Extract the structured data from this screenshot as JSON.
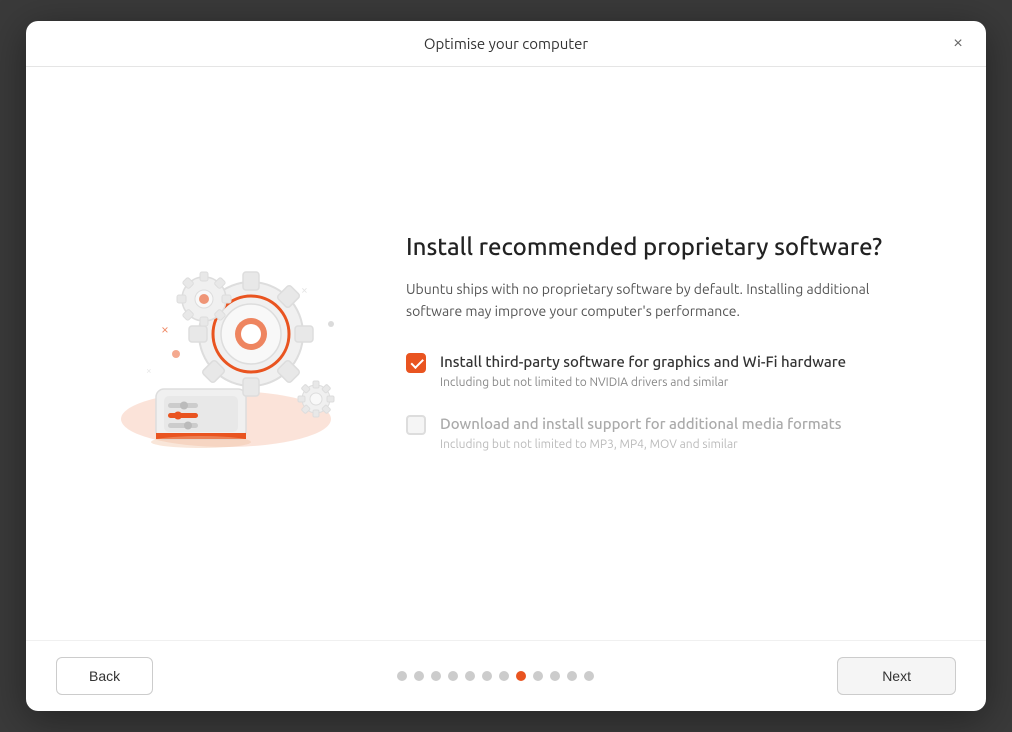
{
  "dialog": {
    "title": "Optimise your computer",
    "close_label": "×"
  },
  "content": {
    "heading": "Install recommended proprietary software?",
    "description": "Ubuntu ships with no proprietary software by default. Installing additional software may improve your computer's performance.",
    "options": [
      {
        "id": "third-party",
        "label": "Install third-party software for graphics and Wi-Fi hardware",
        "sublabel": "Including but not limited to NVIDIA drivers and similar",
        "checked": true,
        "disabled": false
      },
      {
        "id": "media-formats",
        "label": "Download and install support for additional media formats",
        "sublabel": "Including but not limited to MP3, MP4, MOV and similar",
        "checked": false,
        "disabled": true
      }
    ]
  },
  "footer": {
    "back_label": "Back",
    "next_label": "Next",
    "pagination": {
      "total": 12,
      "active_index": 7
    }
  }
}
